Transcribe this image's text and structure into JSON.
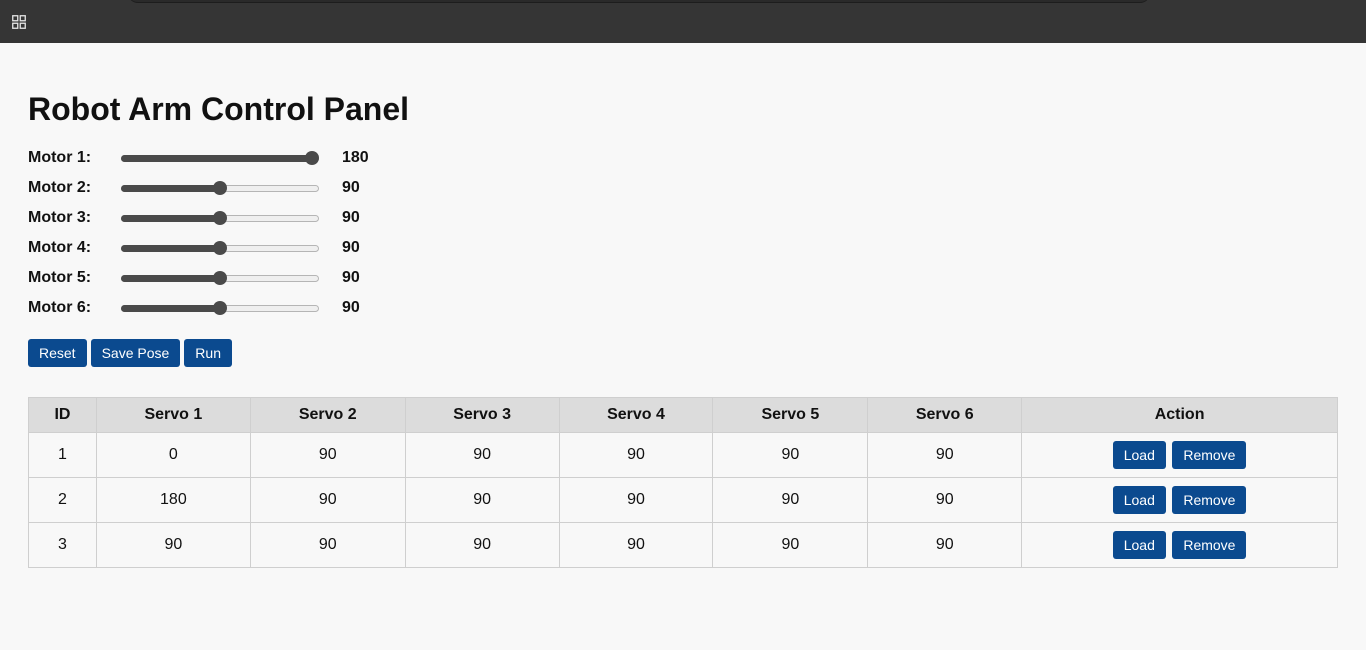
{
  "title": "Robot Arm Control Panel",
  "motors": [
    {
      "label": "Motor 1:",
      "value": "180",
      "fraction": 1.0
    },
    {
      "label": "Motor 2:",
      "value": "90",
      "fraction": 0.5
    },
    {
      "label": "Motor 3:",
      "value": "90",
      "fraction": 0.5
    },
    {
      "label": "Motor 4:",
      "value": "90",
      "fraction": 0.5
    },
    {
      "label": "Motor 5:",
      "value": "90",
      "fraction": 0.5
    },
    {
      "label": "Motor 6:",
      "value": "90",
      "fraction": 0.5
    }
  ],
  "buttons": {
    "reset": "Reset",
    "save_pose": "Save Pose",
    "run": "Run"
  },
  "table": {
    "headers": [
      "ID",
      "Servo 1",
      "Servo 2",
      "Servo 3",
      "Servo 4",
      "Servo 5",
      "Servo 6",
      "Action"
    ],
    "rows": [
      {
        "cells": [
          "1",
          "0",
          "90",
          "90",
          "90",
          "90",
          "90"
        ],
        "load": "Load",
        "remove": "Remove"
      },
      {
        "cells": [
          "2",
          "180",
          "90",
          "90",
          "90",
          "90",
          "90"
        ],
        "load": "Load",
        "remove": "Remove"
      },
      {
        "cells": [
          "3",
          "90",
          "90",
          "90",
          "90",
          "90",
          "90"
        ],
        "load": "Load",
        "remove": "Remove"
      }
    ]
  },
  "icons": {
    "taskbar": "apps-grid-icon"
  },
  "colors": {
    "button": "#0b4a8f",
    "topbar": "#353535",
    "slider": "#4a4a4a",
    "table_header": "#dcdcdc",
    "background": "#f8f8f8"
  }
}
